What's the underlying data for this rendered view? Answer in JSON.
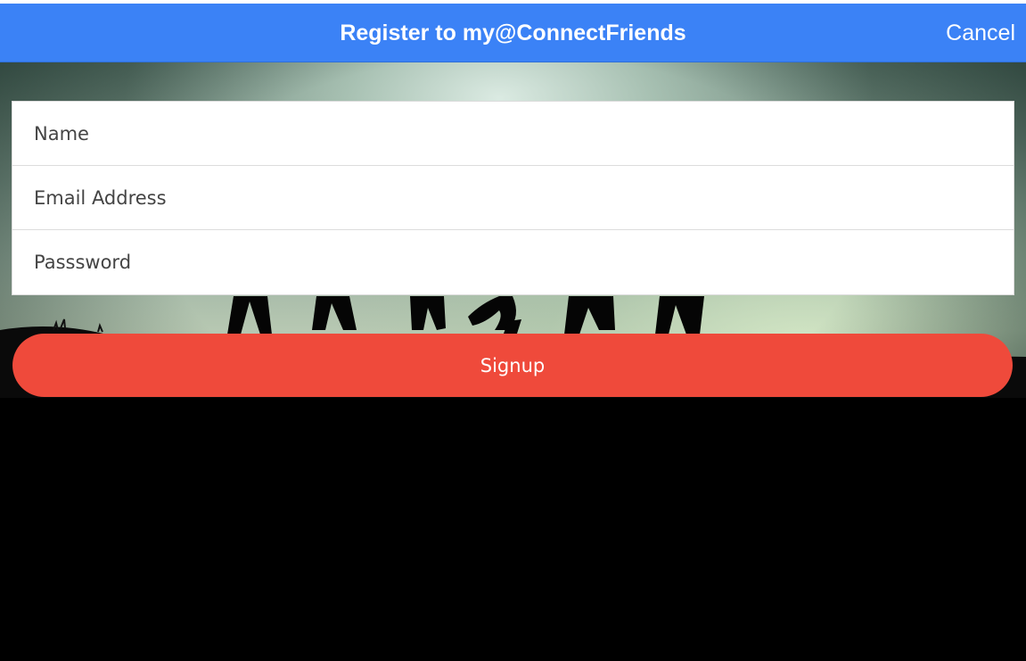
{
  "header": {
    "title": "Register to my@ConnectFriends",
    "cancel_label": "Cancel"
  },
  "form": {
    "name_placeholder": "Name",
    "name_value": "",
    "email_placeholder": "Email Address",
    "email_value": "",
    "password_placeholder": "Passsword",
    "password_value": ""
  },
  "actions": {
    "signup_label": "Signup"
  },
  "colors": {
    "header_bg": "#3b82f6",
    "signup_bg": "#ef4a3b",
    "page_bg": "#000000"
  }
}
